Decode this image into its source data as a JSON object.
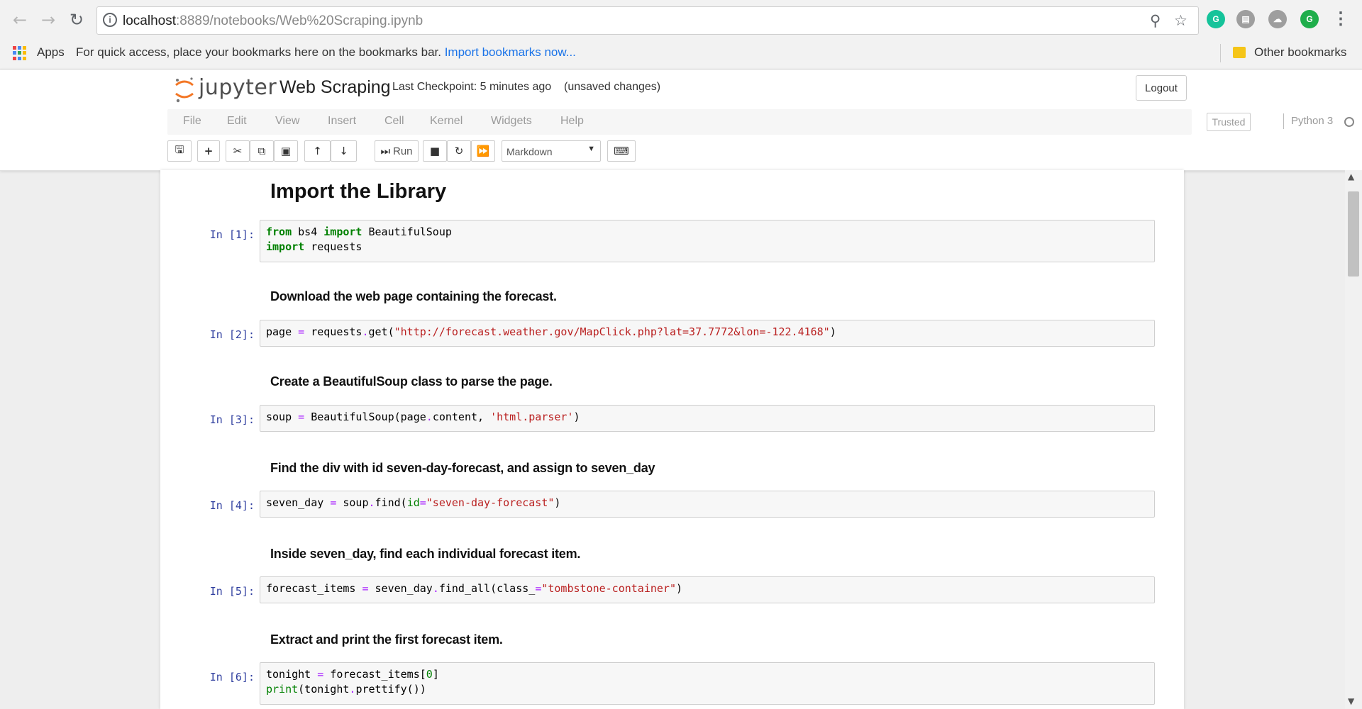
{
  "browser": {
    "url_host": "localhost",
    "url_rest": ":8889/notebooks/Web%20Scraping.ipynb",
    "bookmarks_apps": "Apps",
    "bookmarks_hint": "For quick access, place your bookmarks here on the bookmarks bar.",
    "bookmarks_import": "Import bookmarks now...",
    "other_bookmarks": "Other bookmarks",
    "extensions": [
      {
        "name": "grammarly-extension-icon",
        "color": "#15c39a"
      },
      {
        "name": "extension-icon-2",
        "color": "#9e9e9e"
      },
      {
        "name": "extension-icon-3",
        "color": "#9e9e9e"
      },
      {
        "name": "extension-icon-4",
        "color": "#1fae4b"
      }
    ]
  },
  "jupyter": {
    "logo_text": "jupyter",
    "notebook_title": "Web Scraping",
    "checkpoint": "Last Checkpoint: 5 minutes ago",
    "unsaved": "(unsaved changes)",
    "logout_label": "Logout",
    "menu": [
      "File",
      "Edit",
      "View",
      "Insert",
      "Cell",
      "Kernel",
      "Widgets",
      "Help"
    ],
    "trusted_label": "Trusted",
    "kernel_name": "Python 3",
    "run_label": "Run",
    "cell_type": "Markdown"
  },
  "notebook": {
    "heading": "Import the Library",
    "md1": "Download the web page containing the forecast.",
    "md2": "Create a BeautifulSoup class to parse the page.",
    "md3": "Find the div with id seven-day-forecast, and assign to seven_day",
    "md4": "Inside seven_day, find each individual forecast item.",
    "md5": "Extract and print the first forecast item.",
    "cells": [
      {
        "prompt": "In [1]:",
        "lines": [
          "from bs4 import BeautifulSoup",
          "import requests"
        ]
      },
      {
        "prompt": "In [2]:",
        "lines": [
          "page = requests.get(\"http://forecast.weather.gov/MapClick.php?lat=37.7772&lon=-122.4168\")"
        ]
      },
      {
        "prompt": "In [3]:",
        "lines": [
          "soup = BeautifulSoup(page.content, 'html.parser')"
        ]
      },
      {
        "prompt": "In [4]:",
        "lines": [
          "seven_day = soup.find(id=\"seven-day-forecast\")"
        ]
      },
      {
        "prompt": "In [5]:",
        "lines": [
          "forecast_items = seven_day.find_all(class_=\"tombstone-container\")"
        ]
      },
      {
        "prompt": "In [6]:",
        "lines": [
          "tonight = forecast_items[0]",
          "print(tonight.prettify())"
        ]
      }
    ]
  }
}
